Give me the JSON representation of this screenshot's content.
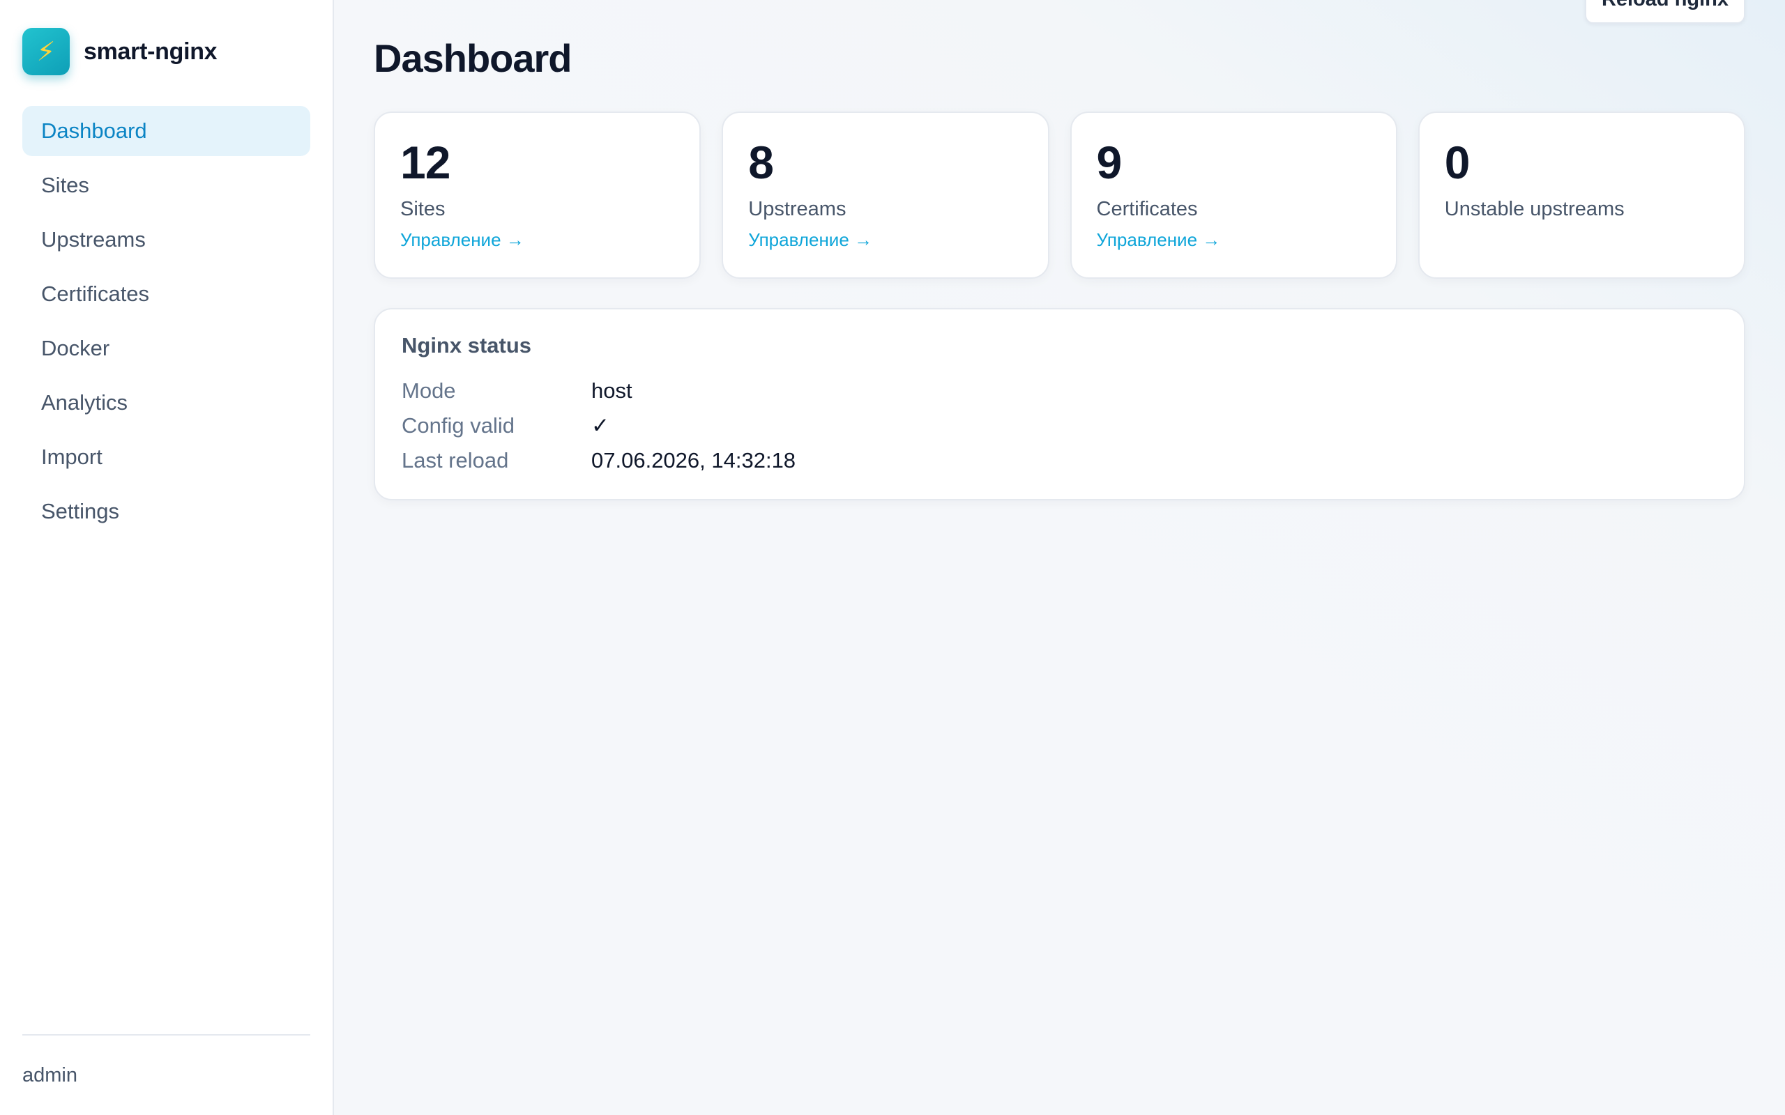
{
  "brand": {
    "logo_icon": "lightning-bolt-icon",
    "logo_glyph": "⚡",
    "name": "smart-nginx"
  },
  "nav": {
    "items": [
      {
        "label": "Dashboard",
        "active": true
      },
      {
        "label": "Sites"
      },
      {
        "label": "Upstreams"
      },
      {
        "label": "Certificates"
      },
      {
        "label": "Docker"
      },
      {
        "label": "Analytics"
      },
      {
        "label": "Import"
      },
      {
        "label": "Settings"
      }
    ]
  },
  "user": {
    "name": "admin"
  },
  "header": {
    "title": "Dashboard",
    "reload_label": "Reload nginx"
  },
  "stats": [
    {
      "value": "12",
      "label": "Sites",
      "link": "Управление →"
    },
    {
      "value": "8",
      "label": "Upstreams",
      "link": "Управление →"
    },
    {
      "value": "9",
      "label": "Certificates",
      "link": "Управление →"
    },
    {
      "value": "0",
      "label": "Unstable upstreams"
    }
  ],
  "status": {
    "title": "Nginx status",
    "rows": [
      {
        "key": "Mode",
        "value": "host"
      },
      {
        "key": "Config valid",
        "value": "✓"
      },
      {
        "key": "Last reload",
        "value": "07.06.2026, 14:32:18"
      }
    ]
  },
  "colors": {
    "accent": "#0b84c4",
    "link": "#0ea5d9",
    "active_bg": "#e4f3fb",
    "logo_gradient_start": "#22c3cf",
    "logo_gradient_end": "#0e9fb7"
  }
}
